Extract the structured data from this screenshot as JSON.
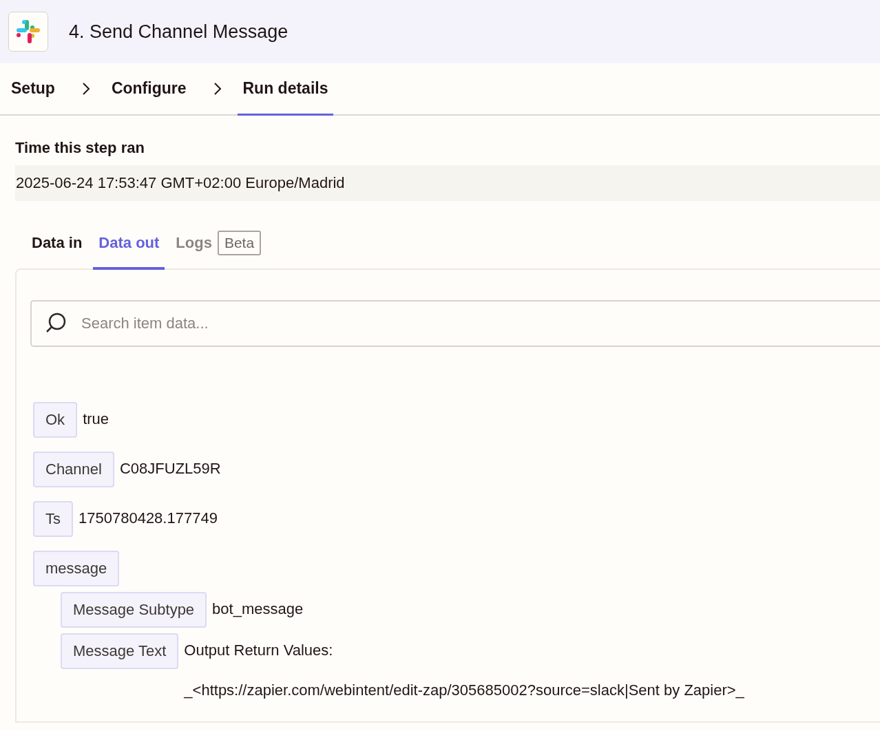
{
  "header": {
    "title": "4. Send Channel Message"
  },
  "steps": [
    {
      "label": "Setup",
      "selected": false
    },
    {
      "label": "Configure",
      "selected": false
    },
    {
      "label": "Run details",
      "selected": true
    }
  ],
  "time": {
    "label": "Time this step ran",
    "value": "2025-06-24 17:53:47 GMT+02:00 Europe/Madrid"
  },
  "tabs": [
    {
      "label": "Data in",
      "selected": false
    },
    {
      "label": "Data out",
      "selected": true
    },
    {
      "label": "Logs",
      "selected": false,
      "badge": "Beta"
    }
  ],
  "search": {
    "placeholder": "Search item data..."
  },
  "items": [
    {
      "key": "Ok",
      "value": [
        "true"
      ]
    },
    {
      "key": "Channel",
      "value": [
        "C08JFUZL59R"
      ]
    },
    {
      "key": "Ts",
      "value": [
        "1750780428.177749"
      ]
    },
    {
      "key": "message",
      "children": [
        {
          "key": "Message Subtype",
          "value": [
            "bot_message"
          ]
        },
        {
          "key": "Message Text",
          "value": [
            "Output Return Values:",
            "_<https://zapier.com/webintent/edit-zap/305685002?source=slack|Sent by Zapier>_"
          ]
        }
      ]
    }
  ]
}
